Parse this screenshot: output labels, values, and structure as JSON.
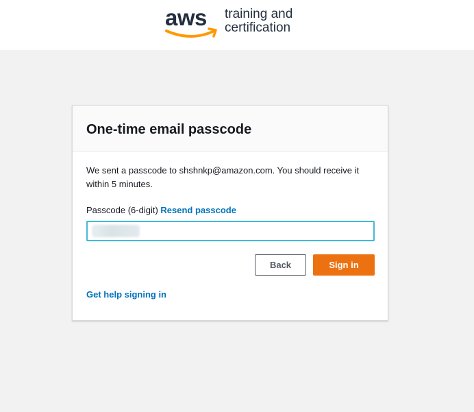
{
  "header": {
    "logo_wordmark": "aws",
    "logo_line1": "training and",
    "logo_line2": "certification",
    "smile_color": "#ff9900"
  },
  "card": {
    "title": "One-time email passcode",
    "info": "We sent a passcode to shshnkp@amazon.com. You should receive it within 5 minutes.",
    "field_label": "Passcode (6-digit)",
    "resend_link": "Resend passcode",
    "passcode_value": "",
    "back_button": "Back",
    "signin_button": "Sign in",
    "help_link": "Get help signing in"
  },
  "colors": {
    "accent_orange": "#ec7211",
    "link_blue": "#0073bb",
    "input_focus": "#44b9d6"
  }
}
